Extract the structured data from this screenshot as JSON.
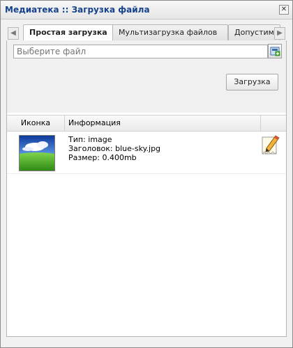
{
  "window": {
    "title": "Медиатека :: Загрузка файла",
    "close_glyph": "✕",
    "icons": {
      "close": "close-icon"
    }
  },
  "tabs": {
    "items": [
      {
        "label": "Простая загрузка",
        "active": true
      },
      {
        "label": "Мультизагрузка файлов",
        "active": false
      },
      {
        "label": "Допустим",
        "active": false
      }
    ],
    "scroll_left_glyph": "◀",
    "scroll_right_glyph": "▶"
  },
  "upload": {
    "file_placeholder": "Выберите файл",
    "file_value": "",
    "button_label": "Загрузка",
    "icons": {
      "browse": "browse-file-icon"
    }
  },
  "grid": {
    "columns": [
      {
        "label": "Иконка"
      },
      {
        "label": "Информация"
      },
      {
        "label": ""
      }
    ],
    "rows": [
      {
        "thumbnail": "blue-sky-thumbnail",
        "type": "Тип: image",
        "title": "Заголовок: blue-sky.jpg",
        "size": "Размер: 0.400mb",
        "edit_icon": "edit-pencil-icon"
      }
    ]
  },
  "colors": {
    "title_text": "#15428b",
    "sky": "#2f6fd0",
    "grass": "#4bb32c"
  }
}
